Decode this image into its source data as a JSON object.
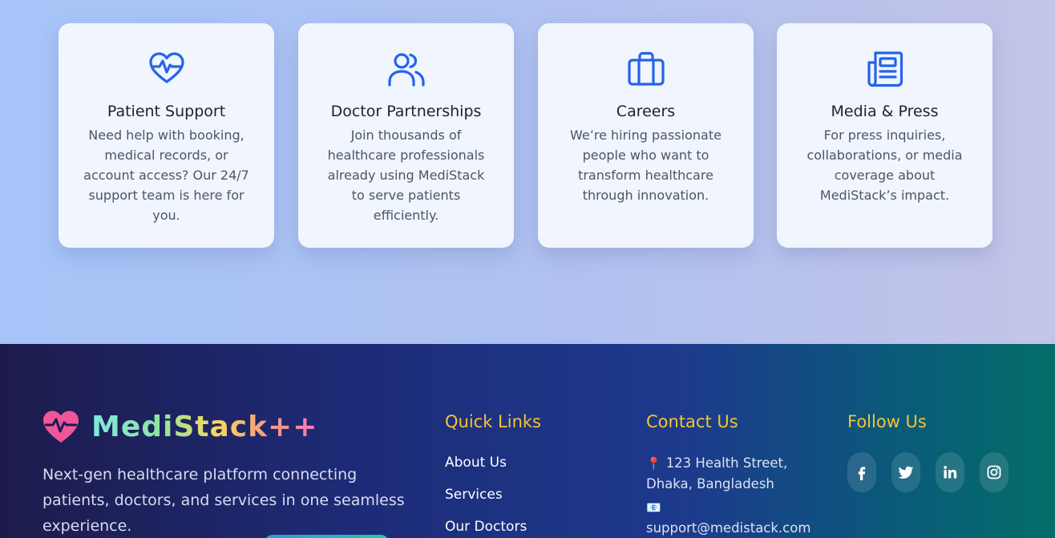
{
  "cards": [
    {
      "icon": "heart-pulse-icon",
      "title": "Patient Support",
      "text": "Need help with booking, medical records, or account access? Our 24/7 support team is here for you."
    },
    {
      "icon": "users-icon",
      "title": "Doctor Partnerships",
      "text": "Join thousands of healthcare professionals already using MediStack to serve patients efficiently."
    },
    {
      "icon": "briefcase-icon",
      "title": "Careers",
      "text": "We’re hiring passionate people who want to transform healthcare through innovation."
    },
    {
      "icon": "newspaper-icon",
      "title": "Media & Press",
      "text": "For press inquiries, collaborations, or media coverage about MediStack’s impact."
    }
  ],
  "footer": {
    "brand": {
      "name": "MediStack++",
      "logo_icon": "heart-pulse-logo-icon"
    },
    "tagline": "Next-gen healthcare platform connecting patients, doctors, and services in one seamless experience.",
    "quick_links": {
      "title": "Quick Links",
      "items": [
        "About Us",
        "Services",
        "Our Doctors"
      ]
    },
    "contact": {
      "title": "Contact Us",
      "address_icon": "📍",
      "address": "123 Health Street, Dhaka, Bangladesh",
      "email_icon": "📧",
      "email": "support@medistack.com"
    },
    "follow": {
      "title": "Follow Us",
      "icons": [
        "facebook-icon",
        "twitter-icon",
        "linkedin-icon",
        "instagram-icon"
      ]
    }
  },
  "colors": {
    "accent_blue": "#2563eb",
    "heading_yellow": "#f6c431",
    "brand_pink": "#f0569a"
  }
}
